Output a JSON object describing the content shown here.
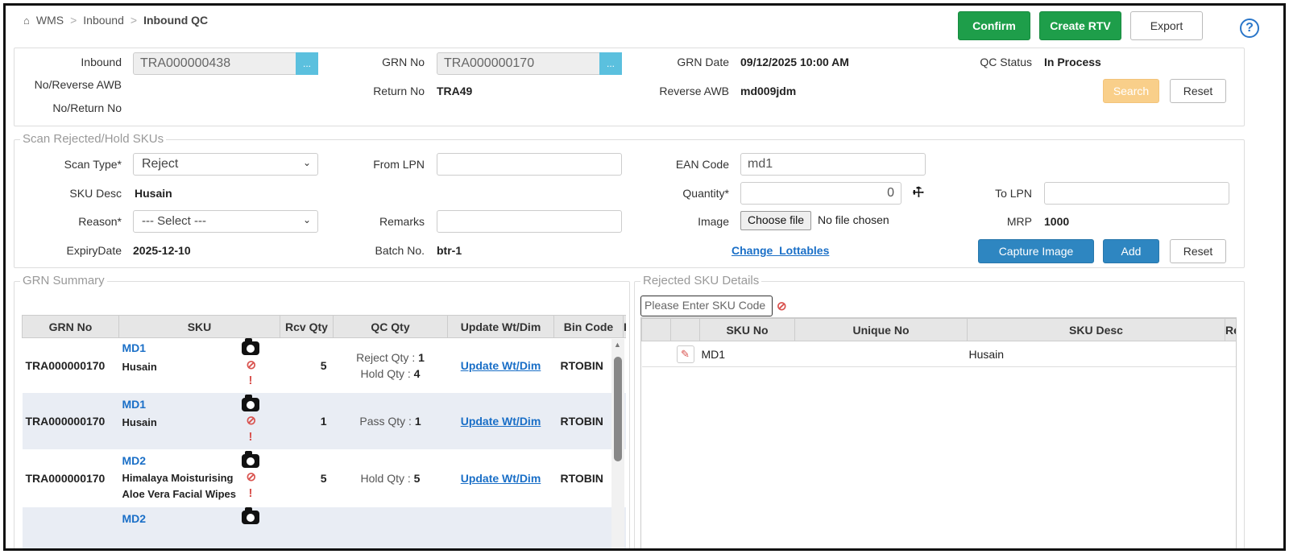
{
  "breadcrumb": {
    "home": "WMS",
    "level1": "Inbound",
    "current": "Inbound QC"
  },
  "toolbar": {
    "confirm": "Confirm",
    "create_rtv": "Create RTV",
    "export": "Export",
    "help": "?"
  },
  "header": {
    "inbound_label_1": "Inbound",
    "inbound_label_2": "No/Reverse AWB",
    "inbound_label_3": "No/Return No",
    "inbound_value": "TRA000000438",
    "grn_no_label": "GRN No",
    "grn_no_value": "TRA000000170",
    "lookup": "...",
    "return_no_label": "Return No",
    "return_no_value": "TRA49",
    "grn_date_label": "GRN Date",
    "grn_date_value": "09/12/2025 10:00 AM",
    "reverse_awb_label": "Reverse AWB",
    "reverse_awb_value": "md009jdm",
    "qc_status_label": "QC Status",
    "qc_status_value": "In Process",
    "search": "Search",
    "reset": "Reset"
  },
  "scan": {
    "legend": "Scan Rejected/Hold SKUs",
    "scan_type_label": "Scan Type*",
    "scan_type_value": "Reject",
    "from_lpn_label": "From LPN",
    "from_lpn_value": "",
    "ean_label": "EAN Code",
    "ean_value": "md1",
    "sku_desc_label": "SKU Desc",
    "sku_desc_value": "Husain",
    "quantity_label": "Quantity*",
    "quantity_value": "0",
    "to_lpn_label": "To LPN",
    "to_lpn_value": "",
    "reason_label": "Reason*",
    "reason_value": "--- Select ---",
    "remarks_label": "Remarks",
    "remarks_value": "",
    "image_label": "Image",
    "choose_file": "Choose file",
    "no_file": "No file chosen",
    "mrp_label": "MRP",
    "mrp_value": "1000",
    "expiry_label": "ExpiryDate",
    "expiry_value": "2025-12-10",
    "batch_label": "Batch No.",
    "batch_value": "btr-1",
    "change_lottables": "Change_Lottables",
    "capture_image": "Capture Image",
    "add": "Add",
    "reset": "Reset"
  },
  "grn_summary": {
    "legend": "GRN Summary",
    "columns": [
      "GRN No",
      "SKU",
      "Rcv Qty",
      "QC Qty",
      "Update Wt/Dim",
      "Bin Code",
      "I"
    ],
    "rows": [
      {
        "grn": "TRA000000170",
        "sku": "MD1",
        "desc1": "Husain",
        "desc2": "",
        "rcv": "5",
        "q1l": "Reject Qty :",
        "q1v": "1",
        "q2l": "Hold Qty :",
        "q2v": "4",
        "update": "Update Wt/Dim",
        "bin": "RTOBIN"
      },
      {
        "grn": "TRA000000170",
        "sku": "MD1",
        "desc1": "Husain",
        "desc2": "",
        "rcv": "1",
        "q1l": "Pass Qty :",
        "q1v": "1",
        "q2l": "",
        "q2v": "",
        "update": "Update Wt/Dim",
        "bin": "RTOBIN"
      },
      {
        "grn": "TRA000000170",
        "sku": "MD2",
        "desc1": "Himalaya Moisturising",
        "desc2": "Aloe Vera Facial Wipes",
        "rcv": "5",
        "q1l": "Hold Qty :",
        "q1v": "5",
        "q2l": "",
        "q2v": "",
        "update": "Update Wt/Dim",
        "bin": "RTOBIN"
      },
      {
        "grn": "",
        "sku": "MD2",
        "desc1": "",
        "desc2": "",
        "rcv": "",
        "q1l": "",
        "q1v": "",
        "q2l": "",
        "q2v": "",
        "update": "",
        "bin": ""
      }
    ]
  },
  "rejected": {
    "legend": "Rejected SKU Details",
    "search_placeholder": "Please Enter SKU Code",
    "columns": [
      "",
      "SKU No",
      "Unique No",
      "SKU Desc",
      "Re"
    ],
    "rows": [
      {
        "sku": "MD1",
        "unique": "",
        "desc": "Husain"
      }
    ]
  }
}
